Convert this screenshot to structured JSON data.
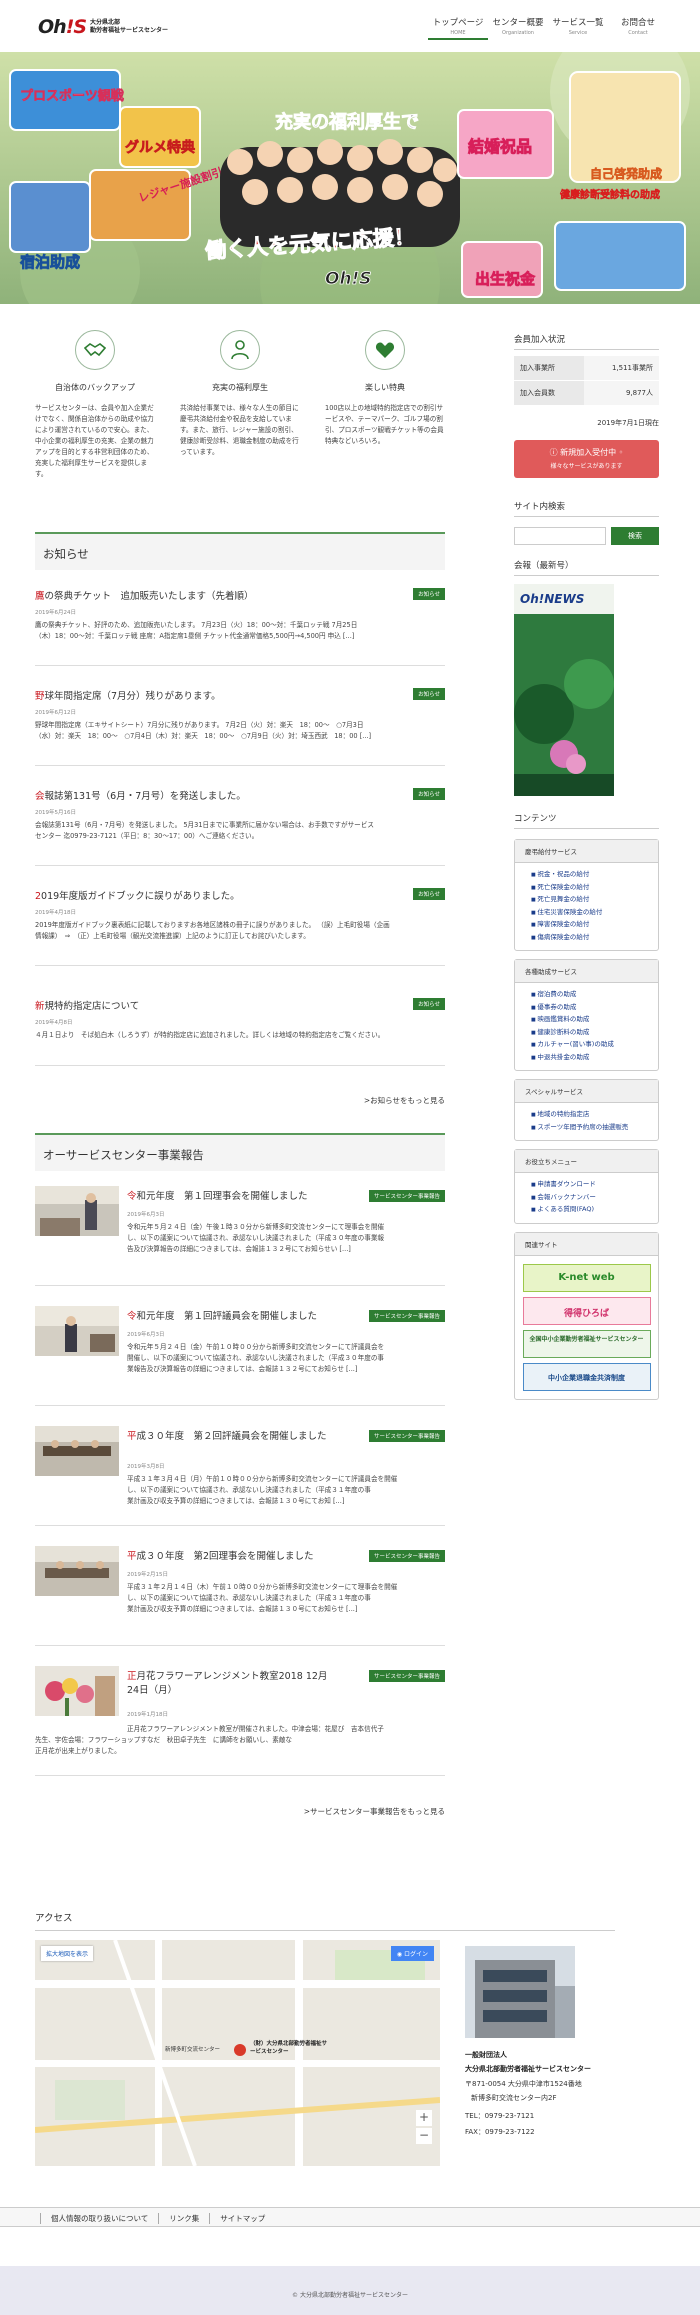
{
  "header": {
    "logo_text": "Oh",
    "logo_ex": "!S",
    "logo_sub1": "大分県北部",
    "logo_sub2": "勤労者福祉サービスセンター",
    "nav": [
      {
        "label": "トップページ",
        "sub": "HOME"
      },
      {
        "label": "センター概要",
        "sub": "Organization"
      },
      {
        "label": "サービス一覧",
        "sub": "Service"
      },
      {
        "label": "お問合せ",
        "sub": "Contact"
      }
    ]
  },
  "hero": {
    "banner1": "プロスポーツ観戦",
    "banner2": "グルメ特典",
    "banner3": "レジャー施設割引",
    "banner4": "宿泊助成",
    "title": "充実の福利厚生で",
    "slogan": "働く人を元気に応援！",
    "brand": "Oh!S",
    "r1": "結婚祝品",
    "r2": "自己啓発助成",
    "r3": "健康診断受診料の助成",
    "r4": "出生祝金"
  },
  "features": [
    {
      "title": "自治体のバックアップ",
      "text": "サービスセンターは、会員や加入企業だけでなく、関係自治体からの助成や協力により運営されているので安心。また、中小企業の福利厚生の充実、企業の魅力アップを目的とする非営利団体のため、充実した福利厚生サービスを提供します。"
    },
    {
      "title": "充実の福利厚生",
      "text": "共済給付事業では、様々な人生の節目に慶弔共済給付金や祝品を支給しています。また、旅行、レジャー施設の割引、健康診断受診料、退職金制度の助成を行っています。"
    },
    {
      "title": "楽しい特典",
      "text": "100店以上の地域特約指定店での割引サービスや、テーマパーク、ゴルフ場の割引、プロスポーツ観戦チケット等の会員特典などいろいろ。"
    }
  ],
  "news_section": {
    "title": "お知らせ",
    "more": ">お知らせをもっと見る",
    "items": [
      {
        "pre": "鷹",
        "title": "の祭典チケット　追加販売いたします（先着順）",
        "badge": "お知らせ",
        "date": "2019年6月24日",
        "body1": "鷹の祭典チケット、好評のため、追加販売いたします。 7月23日（火）18：00〜対：千葉ロッテ戦 7月25日",
        "body2": "（木）18：00〜対：千葉ロッテ戦 座席：A指定席1塁側 チケット代金通常価格5,500円→4,500円 申込 [...]"
      },
      {
        "pre": "野",
        "title": "球年間指定席（7月分）残りがあります。",
        "badge": "お知らせ",
        "date": "2019年6月12日",
        "body1": "野球年間指定席（エキサイトシート）7月分に残りがあります。 7月2日（火）対：楽天　18：00〜　○7月3日",
        "body2": "（水）対：楽天　18：00〜　○7月4日（木）対：楽天　18：00〜　○7月9日（火）対：埼玉西武　18：00 [...]"
      },
      {
        "pre": "会",
        "title": "報誌第131号（6月・7月号）を発送しました。",
        "badge": "お知らせ",
        "date": "2019年5月16日",
        "body1": "会報誌第131号（6月・7月号）を発送しました。 5月31日までに事業所に届かない場合は、お手数ですがサービス",
        "body2": "センター 迄0979-23-7121（平日：8：30〜17：00）へご連絡ください。"
      },
      {
        "pre": "2",
        "title": "019年度版ガイドブックに誤りがありました。",
        "badge": "お知らせ",
        "date": "2019年4月18日",
        "body1": "2019年度版ガイドブック裏表紙に記載しておりますお各地区諸株の冊子に誤りがありました。 （誤）上毛町役場（企画",
        "body2": "情報課）　⇒　（正）上毛町役場（観光交流推進課）上記のように訂正してお詫びいたします。"
      },
      {
        "pre": "新",
        "title": "規特約指定店について",
        "badge": "お知らせ",
        "date": "2019年4月8日",
        "body1": "４月１日より　そば処白木（しろうず）が特約指定店に追加されました。詳しくは地域の特約指定店をご覧ください。",
        "body2": ""
      }
    ]
  },
  "report_section": {
    "title": "オーサービスセンター事業報告",
    "more": ">サービスセンター事業報告をもっと見る",
    "items": [
      {
        "pre": "令",
        "title": "和元年度　第１回理事会を開催しました",
        "badge": "サービスセンター事業報告",
        "date": "2019年6月3日",
        "body1": "令和元年５月２４日（金）午後１時３０分から新博多町交流センターにて理事会を開催",
        "body2": "し、以下の議案について協議され、承認ないし決議されました（平成３０年度の事業報",
        "body3": "告及び決算報告の詳細につきましては、会報誌１３２号にてお知らせい [...]"
      },
      {
        "pre": "令",
        "title": "和元年度　第１回評議員会を開催しました",
        "badge": "サービスセンター事業報告",
        "date": "2019年6月3日",
        "body1": "令和元年５月２４日（金）午前１０時００分から新博多町交流センターにて評議員会を",
        "body2": "開催し、以下の議案について協議され、承認ないし決議されました（平成３０年度の事",
        "body3": "業報告及び決算報告の詳細につきましては、会報誌１３２号にてお知らせ [...]"
      },
      {
        "pre": "平",
        "title": "成３０年度　第２回評議員会を開催しました",
        "badge": "サービスセンター事業報告",
        "date": "2019年3月8日",
        "body1": "平成３１年３月４日（月）午前１０時００分から新博多町交流センターにて評議員会を開催",
        "body2": "し、以下の議案について協議され、承認ないし決議されました（平成３１年度の事",
        "body3": "業計画及び収支予算の詳細につきましては、会報誌１３０号にてお知 [...]"
      },
      {
        "pre": "平",
        "title": "成３０年度　第2回理事会を開催しました",
        "badge": "サービスセンター事業報告",
        "date": "2019年2月15日",
        "body1": "平成３１年２月１４日（木）午前１０時００分から新博多町交流センターにて理事会を開催",
        "body2": "し、以下の議案について協議され、承認ないし決議されました（平成３１年度の事",
        "body3": "業計画及び収支予算の詳細につきましては、会報誌１３０号にてお知らせ [...]"
      },
      {
        "pre": "正",
        "title": "月花フラワーアレンジメント教室2018 12月24日（月）",
        "badge": "サービスセンター事業報告",
        "date": "2019年1月18日",
        "body1": "正月花フラワーアレンジメント教室が開催されました。中津会場：花屋び　吉本信代子",
        "body2": "先生、宇佐会場：フラワーショップすなだ　秋田卓子先生　に講師をお願いし、素敵な",
        "body3": "正月花が出来上がりました。"
      }
    ]
  },
  "access": {
    "title": "アクセス",
    "map_btn": "拡大地図を表示",
    "map_login": "ログイン",
    "map_label1": "（財）大分県北部勤労者福祉サービスセンター",
    "map_label2": "新博多町交流センター",
    "org_type": "一般財団法人",
    "org_name": "大分県北部勤労者福祉サービスセンター",
    "addr1": "〒871-0054 大分県中津市1524番地",
    "addr2": "新博多町交流センター内2F",
    "tel": "TEL：0979-23-7121",
    "fax": "FAX：0979-23-7122"
  },
  "sidebar": {
    "member_title": "会員加入状況",
    "members": [
      {
        "k": "加入事業所",
        "v": "1,511事業所"
      },
      {
        "k": "加入会員数",
        "v": "9,877人"
      }
    ],
    "member_date": "2019年7月1日現在",
    "join_btn1": "新規加入受付中",
    "join_btn2": "様々なサービスがあります",
    "search_title": "サイト内検索",
    "search_btn": "検索",
    "mag_title": "会報（最新号）",
    "mag_name": "Oh!NEWS",
    "contents_title": "コンテンツ",
    "boxes": [
      {
        "title": "慶弔給付サービス",
        "items": [
          "祝金・祝品の給付",
          "死亡保険金の給付",
          "死亡見舞金の給付",
          "住宅災害保険金の給付",
          "障害保険金の給付",
          "傷病保険金の給付"
        ]
      },
      {
        "title": "各種助成サービス",
        "items": [
          "宿泊費の助成",
          "優事券の助成",
          "映画鑑賞料の助成",
          "健康診断料の助成",
          "カルチャー(習い事)の助成",
          "中退共掛金の助成"
        ]
      },
      {
        "title": "スペシャルサービス",
        "items": [
          "地域の特約指定店",
          "スポーツ年間予約席の抽選販売"
        ]
      },
      {
        "title": "お役立ちメニュー",
        "items": [
          "申請書ダウンロード",
          "会報バックナンバー",
          "よくある質問(FAQ)"
        ]
      }
    ],
    "links_title": "関連サイト",
    "link1": "K-net web",
    "link2": "得得ひろば",
    "link3": "全国中小企業勤労者福祉サービスセンター",
    "link4": "中小企業退職金共済制度"
  },
  "footer": {
    "links": [
      "個人情報の取り扱いについて",
      "リンク集",
      "サイトマップ"
    ],
    "copyright": "© 大分県北部勤労者福祉サービスセンター"
  },
  "colors": {
    "accent": "#2e7d32",
    "brand_red": "#c8161d",
    "join_btn": "#e05a5a"
  }
}
